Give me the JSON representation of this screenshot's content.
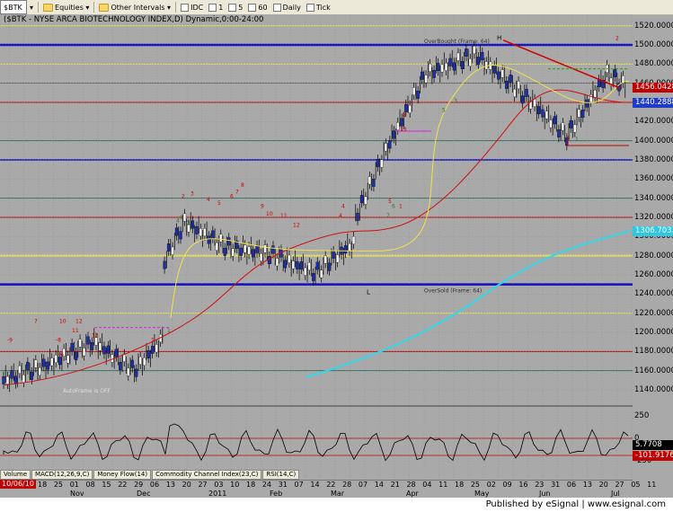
{
  "toolbar": {
    "symbol": "$BTK",
    "equities_label": "Equities",
    "other_intervals_label": "Other Intervals",
    "idc_label": "IDC",
    "intervals": [
      "1",
      "5",
      "60",
      "Daily",
      "Tick"
    ]
  },
  "chart": {
    "title": "($BTK - NYSE ARCA BIOTECHNOLOGY INDEX,D) Dynamic,0:00-24:00",
    "overbought_label": "OverBought (Frame: 64)",
    "oversold_label": "OverSold (Frame: 64)",
    "autoframe_label": "AutoFrame is OFF",
    "low_marker": "L",
    "high_marker": "H",
    "start_date": "10/06/10",
    "price_axis": [
      "1520.0000",
      "1500.0000",
      "1480.0000",
      "1460.0000",
      "1440.0000",
      "1420.0000",
      "1400.0000",
      "1380.0000",
      "1360.0000",
      "1340.0000",
      "1320.0000",
      "1300.0000",
      "1280.0000",
      "1260.0000",
      "1240.0000",
      "1220.0000",
      "1200.0000",
      "1180.0000",
      "1160.0000",
      "1140.0000"
    ],
    "price_tags": [
      {
        "value": "1456.04285",
        "color": "#c00000"
      },
      {
        "value": "1440.2888",
        "color": "#1e3cc8"
      },
      {
        "value": "1306.7033",
        "color": "#30c8e0"
      }
    ],
    "counts_red": [
      "7",
      "10",
      "12",
      "11",
      "13",
      "-9",
      "-8",
      "-6",
      "1",
      "2",
      "3",
      "4",
      "5",
      "6",
      "7",
      "8",
      "9",
      "10",
      "11",
      "12",
      "4",
      "5",
      "13",
      "8",
      "4",
      "1",
      "2"
    ],
    "counts_green": [
      "4",
      "3",
      "2",
      "1",
      "7",
      "6",
      "5",
      "3",
      "1"
    ]
  },
  "indicator": {
    "axis_labels": [
      "250",
      "0",
      "-250"
    ],
    "value_tags": [
      {
        "value": "5.7708",
        "color": "#000000"
      },
      {
        "value": "-101.9176",
        "color": "#c00000"
      }
    ]
  },
  "panel_tabs": [
    "Volume",
    "MACD(12,26,9,C)",
    "Money Flow(14)",
    "Commodity Channel Index(23,C)",
    "RSI(14,C)"
  ],
  "xaxis": {
    "days": [
      "18",
      "25",
      "01",
      "08",
      "15",
      "22",
      "29",
      "06",
      "13",
      "20",
      "27",
      "03",
      "10",
      "18",
      "24",
      "31",
      "07",
      "14",
      "22",
      "28",
      "07",
      "14",
      "21",
      "28",
      "04",
      "11",
      "18",
      "25",
      "02",
      "09",
      "16",
      "23",
      "31",
      "06",
      "13",
      "20",
      "27",
      "05",
      "11"
    ],
    "months": [
      "Nov",
      "Dec",
      "2011",
      "Feb",
      "Mar",
      "Apr",
      "May",
      "Jun",
      "Jul"
    ]
  },
  "footer": "Published by eSignal | www.esignal.com"
}
